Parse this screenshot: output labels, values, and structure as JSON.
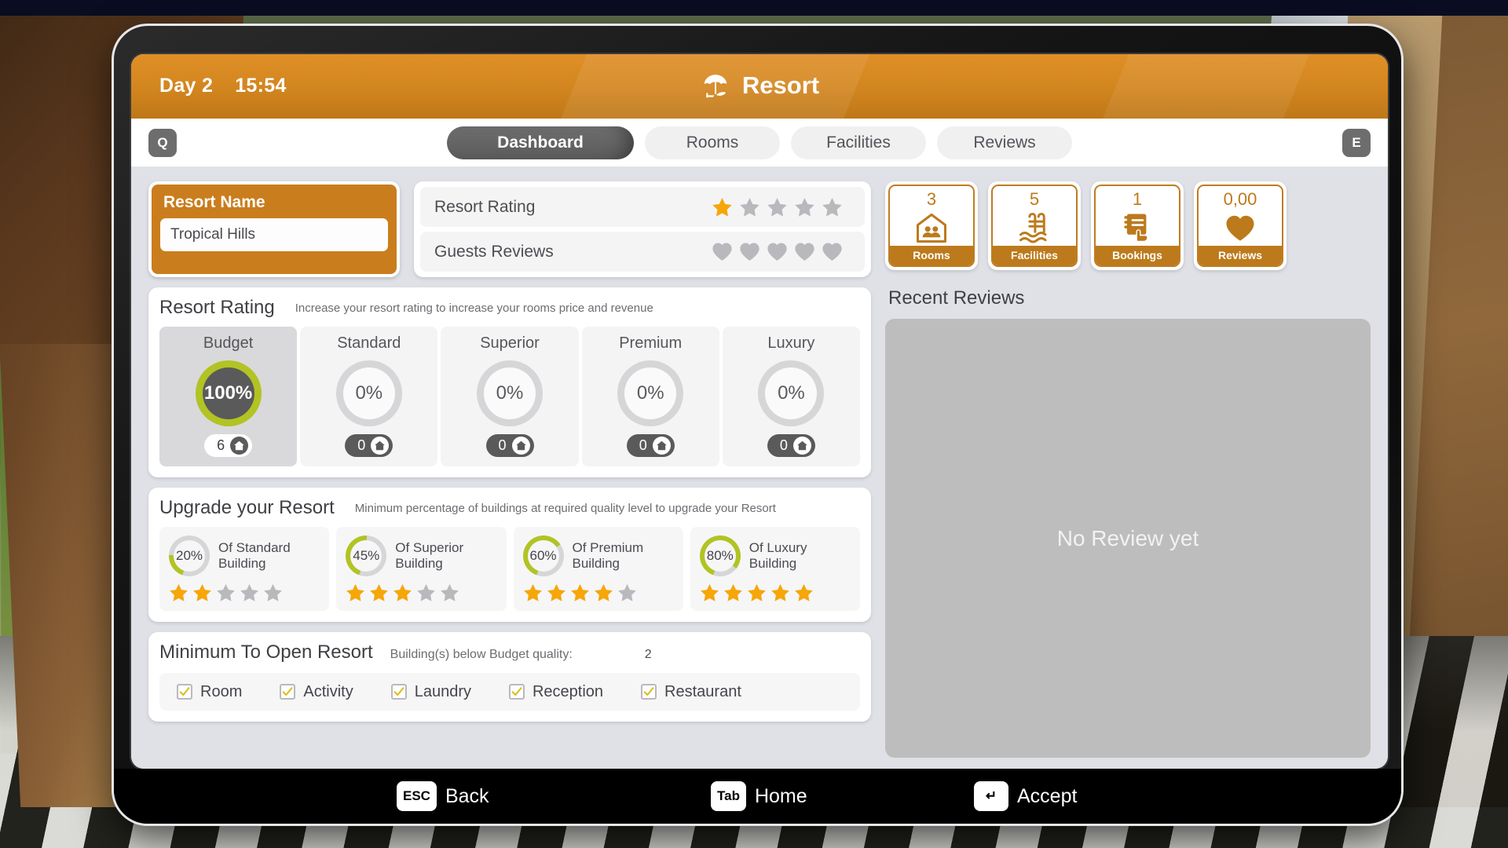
{
  "header": {
    "day_label": "Day 2",
    "time_label": "15:54",
    "title": "Resort",
    "title_icon": "beach-umbrella-icon"
  },
  "tabbar": {
    "left_key": "Q",
    "right_key": "E",
    "tabs": [
      {
        "label": "Dashboard",
        "active": true
      },
      {
        "label": "Rooms",
        "active": false
      },
      {
        "label": "Facilities",
        "active": false
      },
      {
        "label": "Reviews",
        "active": false
      }
    ]
  },
  "resort_name": {
    "label": "Resort Name",
    "value": "Tropical Hills",
    "placeholder": "Resort Name"
  },
  "ratings": {
    "resort_rating_label": "Resort Rating",
    "resort_rating_filled": 1,
    "resort_rating_total": 5,
    "guests_reviews_label": "Guests Reviews",
    "guests_reviews_filled": 0,
    "guests_reviews_total": 5
  },
  "resort_rating_panel": {
    "title": "Resort Rating",
    "subtitle": "Increase your resort rating to increase your rooms price and revenue",
    "tiers": [
      {
        "name": "Budget",
        "percent": "100%",
        "count": "6",
        "active": true
      },
      {
        "name": "Standard",
        "percent": "0%",
        "count": "0",
        "active": false
      },
      {
        "name": "Superior",
        "percent": "0%",
        "count": "0",
        "active": false
      },
      {
        "name": "Premium",
        "percent": "0%",
        "count": "0",
        "active": false
      },
      {
        "name": "Luxury",
        "percent": "0%",
        "count": "0",
        "active": false
      }
    ]
  },
  "upgrade_panel": {
    "title": "Upgrade your Resort",
    "subtitle": "Minimum percentage of buildings at required quality level to upgrade your Resort",
    "items": [
      {
        "percent": "20%",
        "percent_value": 20,
        "text": "Of Standard Building",
        "stars": 2
      },
      {
        "percent": "45%",
        "percent_value": 45,
        "text": "Of Superior Building",
        "stars": 3
      },
      {
        "percent": "60%",
        "percent_value": 60,
        "text": "Of Premium Building",
        "stars": 4
      },
      {
        "percent": "80%",
        "percent_value": 80,
        "text": "Of Luxury Building",
        "stars": 5
      }
    ]
  },
  "minimum_panel": {
    "title": "Minimum To Open Resort",
    "subtitle": "Building(s) below Budget quality:",
    "value": "2",
    "requirements": [
      {
        "label": "Room",
        "checked": true
      },
      {
        "label": "Activity",
        "checked": true
      },
      {
        "label": "Laundry",
        "checked": true
      },
      {
        "label": "Reception",
        "checked": true
      },
      {
        "label": "Restaurant",
        "checked": true
      }
    ]
  },
  "stats": [
    {
      "value": "3",
      "label": "Rooms",
      "icon": "house-people-icon"
    },
    {
      "value": "5",
      "label": "Facilities",
      "icon": "pool-icon"
    },
    {
      "value": "1",
      "label": "Bookings",
      "icon": "booking-hand-icon"
    },
    {
      "value": "0,00",
      "label": "Reviews",
      "icon": "heart-icon"
    }
  ],
  "recent_reviews": {
    "title": "Recent Reviews",
    "empty_text": "No Review yet"
  },
  "bottombar": [
    {
      "key": "ESC",
      "label": "Back"
    },
    {
      "key": "Tab",
      "label": "Home"
    },
    {
      "key": "↵",
      "label": "Accept"
    }
  ],
  "colors": {
    "accent_orange": "#ca7d1c",
    "title_orange": "#d2851f",
    "ring_green": "#b2c324",
    "star_gold": "#f6a609",
    "star_gray": "#b9b9bd",
    "heart_gray": "#b9b9bd",
    "dark_gray": "#5a5a5a"
  }
}
